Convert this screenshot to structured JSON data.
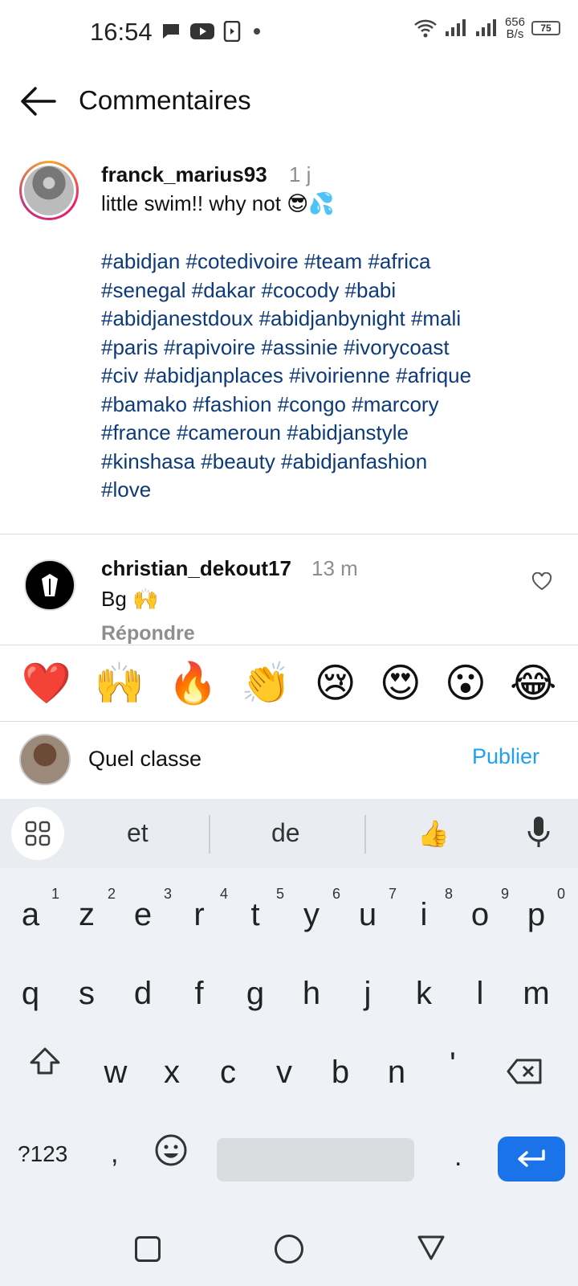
{
  "status_bar": {
    "time": "16:54",
    "net_speed_value": "656",
    "net_speed_unit": "B/s",
    "battery": "75"
  },
  "header": {
    "title": "Commentaires"
  },
  "caption": {
    "username": "franck_marius93",
    "time": "1 j",
    "text": "little swim!! why not 😎💦",
    "hashtag_lines": [
      "#abidjan #cotedivoire #team #africa",
      "#senegal #dakar #cocody #babi",
      "#abidjanestdoux #abidjanbynight #mali",
      "#paris #rapivoire #assinie #ivorycoast",
      "#civ #abidjanplaces #ivoirienne #afrique",
      "#bamako #fashion #congo #marcory",
      "#france #cameroun #abidjanstyle",
      "#kinshasa #beauty #abidjanfashion",
      "#love"
    ]
  },
  "reply": {
    "username": "christian_dekout17",
    "time": "13 m",
    "text": "Bg 🙌",
    "reply_label": "Répondre"
  },
  "emoji_bar": [
    "❤️",
    "🙌",
    "🔥",
    "👏",
    "😢",
    "😍",
    "😮",
    "😂"
  ],
  "comment_input": {
    "value": "Quel classe",
    "publish_label": "Publier"
  },
  "keyboard": {
    "suggestions": [
      "et",
      "de",
      "👍"
    ],
    "row1": [
      {
        "key": "a",
        "num": "1"
      },
      {
        "key": "z",
        "num": "2"
      },
      {
        "key": "e",
        "num": "3"
      },
      {
        "key": "r",
        "num": "4"
      },
      {
        "key": "t",
        "num": "5"
      },
      {
        "key": "y",
        "num": "6"
      },
      {
        "key": "u",
        "num": "7"
      },
      {
        "key": "i",
        "num": "8"
      },
      {
        "key": "o",
        "num": "9"
      },
      {
        "key": "p",
        "num": "0"
      }
    ],
    "row2": [
      "q",
      "s",
      "d",
      "f",
      "g",
      "h",
      "j",
      "k",
      "l",
      "m"
    ],
    "row3": [
      "w",
      "x",
      "c",
      "v",
      "b",
      "n",
      "'"
    ],
    "symbols_label": "?123",
    "comma": ",",
    "period": "."
  }
}
